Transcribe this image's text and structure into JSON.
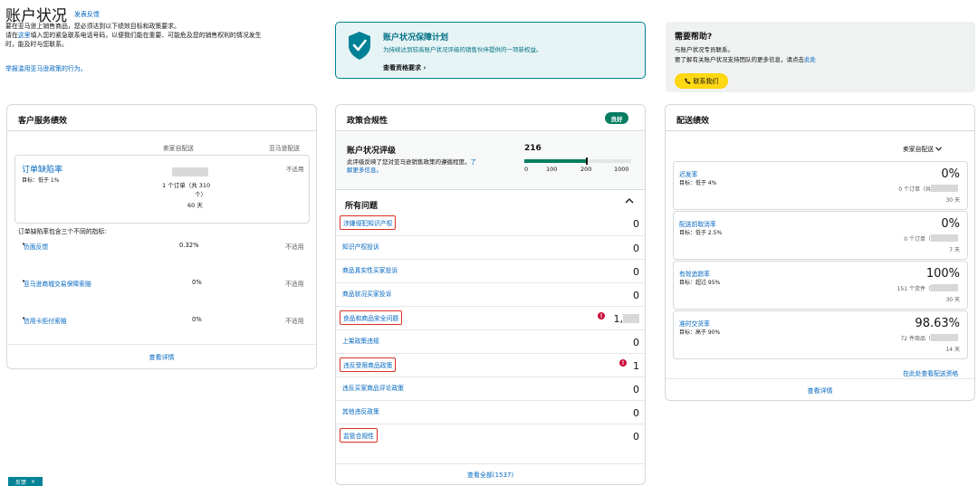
{
  "header": {
    "title": "账户状况",
    "feedback_link": "发表反馈",
    "intro_line1": "要在亚马逊上销售商品，您必须达到以下绩效目标和政策要求。",
    "intro_line2_prefix": "请在",
    "intro_line2_link": "这里",
    "intro_line2_suffix": "填入您的紧急联系电话号码，以便我们能在重要、可能危及您的销售权利的情况发生",
    "intro_line3": "时，能及时与您联系。",
    "report_link": "举报滥用亚马逊政策的行为。"
  },
  "protection_banner": {
    "title": "账户状况保障计划",
    "description": "为持续达到较高账户状况评级的销售伙伴提供的一项新权益。",
    "link": "查看资格要求"
  },
  "help": {
    "title": "需要帮助?",
    "line1": "与账户状况专员联系。",
    "line2_prefix": "要了解有关账户状况支持团队的更多信息，请点击",
    "line2_link": "此处",
    "contact_button": "联系我们"
  },
  "customer_service": {
    "title": "客户服务绩效",
    "col_seller": "卖家自配送",
    "col_amazon": "亚马逊配送",
    "odr": {
      "name": "订单缺陷率",
      "target": "目标：低于 1%",
      "detail_line1": "1 个订单（共 310",
      "detail_line2": "个）",
      "days": "60 天",
      "amazon_value": "不适用"
    },
    "metrics_intro": "订单缺陷率包含三个不同的指标:",
    "metrics": [
      {
        "name": "负面反馈",
        "seller": "0.32%",
        "amazon": "不适用"
      },
      {
        "name": "亚马逊商城交易保障索赔",
        "seller": "0%",
        "amazon": "不适用"
      },
      {
        "name": "信用卡拒付索赔",
        "seller": "0%",
        "amazon": "不适用"
      }
    ],
    "view_details": "查看详情"
  },
  "policy": {
    "title": "政策合规性",
    "status_badge": "良好",
    "ahr": {
      "title": "账户状况评级",
      "desc_main": "此评级反映了您对亚马逊销售政策的遵循程度。",
      "desc_link1": "了",
      "desc_link2": "解更多信息。",
      "score": "216",
      "score_value": 216,
      "scale": [
        "0",
        "100",
        "200",
        "1000"
      ]
    },
    "issues_title": "所有问题",
    "issues": [
      {
        "label": "涉嫌侵犯知识产权",
        "count": "0",
        "highlighted": true,
        "warning": false
      },
      {
        "label": "知识产权投诉",
        "count": "0",
        "highlighted": false,
        "warning": false
      },
      {
        "label": "商品真实性买家投诉",
        "count": "0",
        "highlighted": false,
        "warning": false
      },
      {
        "label": "商品状况买家投诉",
        "count": "0",
        "highlighted": false,
        "warning": false
      },
      {
        "label": "食品和商品安全问题",
        "count": "1,",
        "highlighted": true,
        "warning": true
      },
      {
        "label": "上架政策违规",
        "count": "0",
        "highlighted": false,
        "warning": false
      },
      {
        "label": "违反受限商品政策",
        "count": "1",
        "highlighted": true,
        "warning": true
      },
      {
        "label": "违反买家商品评论政策",
        "count": "0",
        "highlighted": false,
        "warning": false
      },
      {
        "label": "其他违反政策",
        "count": "0",
        "highlighted": false,
        "warning": false
      },
      {
        "label": "监管合规性",
        "count": "0",
        "highlighted": true,
        "warning": false
      }
    ],
    "view_all": "查看全部(1537)"
  },
  "shipping": {
    "title": "配送绩效",
    "dropdown": "卖家自配送",
    "metrics": [
      {
        "name": "迟发率",
        "target": "目标：低于 4%",
        "value": "0%",
        "detail": "0 个订单（共 ",
        "days": "30 天"
      },
      {
        "name": "配送前取消率",
        "target": "目标：低于 2.5%",
        "value": "0%",
        "detail": "0 个订单（",
        "days": "7 天"
      },
      {
        "name": "有效追踪率",
        "target": "目标：超过 95%",
        "value": "100%",
        "detail": "151 个货件（",
        "days": "30 天"
      },
      {
        "name": "准时交货率",
        "target": "目标：高于 90%",
        "value": "98.63%",
        "detail": "72 件商品（",
        "days": "14 天"
      }
    ],
    "view_eligibility": "在此处查看配送资格",
    "view_details": "查看详情"
  },
  "feedback_tab": {
    "label": "反馈",
    "close": "×"
  },
  "colors": {
    "accent": "#0066c0",
    "teal": "#008296",
    "good": "#067d62",
    "warning": "#cc0c39",
    "button": "#ffd814",
    "highlight_box": "#d93025"
  }
}
